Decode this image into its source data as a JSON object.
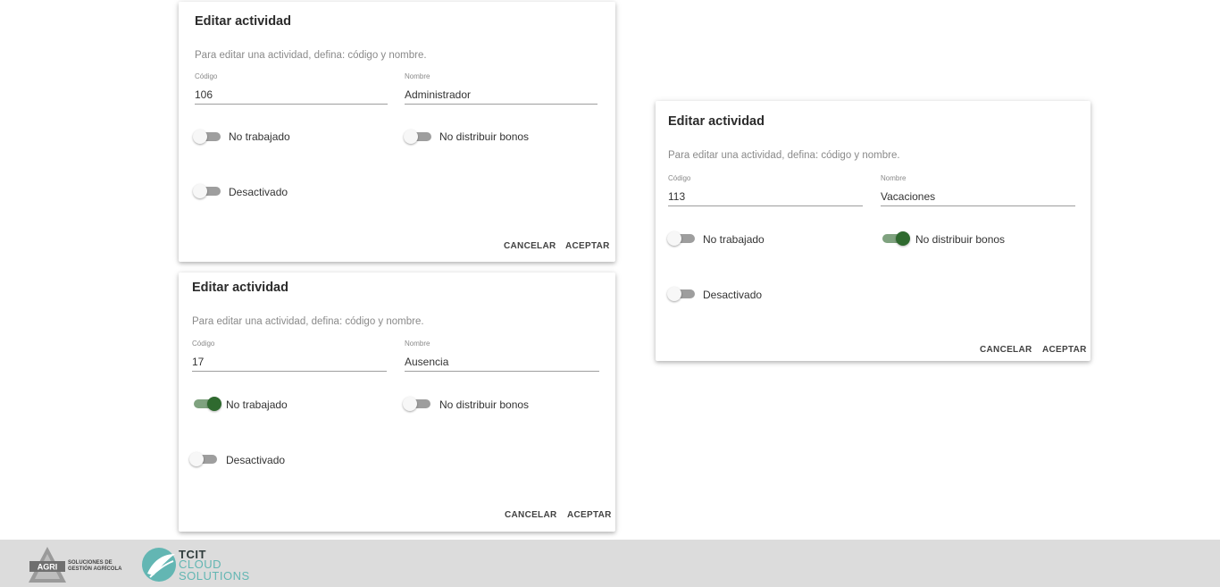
{
  "dialogs": [
    {
      "title": "Editar actividad",
      "subtitle": "Para editar una actividad, defina: código y nombre.",
      "codigo_label": "Código",
      "codigo_value": "106",
      "nombre_label": "Nombre",
      "nombre_value": "Administrador",
      "no_trabajado_label": "No trabajado",
      "no_trabajado_on": false,
      "no_distribuir_label": "No distribuir bonos",
      "no_distribuir_on": false,
      "desactivado_label": "Desactivado",
      "desactivado_on": false,
      "cancel_label": "CANCELAR",
      "accept_label": "ACEPTAR"
    },
    {
      "title": "Editar actividad",
      "subtitle": "Para editar una actividad, defina: código y nombre.",
      "codigo_label": "Código",
      "codigo_value": "17",
      "nombre_label": "Nombre",
      "nombre_value": "Ausencia",
      "no_trabajado_label": "No trabajado",
      "no_trabajado_on": true,
      "no_distribuir_label": "No distribuir bonos",
      "no_distribuir_on": false,
      "desactivado_label": "Desactivado",
      "desactivado_on": false,
      "cancel_label": "CANCELAR",
      "accept_label": "ACEPTAR"
    },
    {
      "title": "Editar actividad",
      "subtitle": "Para editar una actividad, defina: código y nombre.",
      "codigo_label": "Código",
      "codigo_value": "113",
      "nombre_label": "Nombre",
      "nombre_value": "Vacaciones",
      "no_trabajado_label": "No trabajado",
      "no_trabajado_on": false,
      "no_distribuir_label": "No distribuir bonos",
      "no_distribuir_on": true,
      "desactivado_label": "Desactivado",
      "desactivado_on": false,
      "cancel_label": "CANCELAR",
      "accept_label": "ACEPTAR"
    }
  ],
  "footer": {
    "agri_logo_text": "AGRI",
    "agri_tagline_1": "SOLUCIONES DE",
    "agri_tagline_2": "GESTIÓN AGRÍCOLA",
    "tcit_title": "TCIT",
    "tcit_line_1": "CLOUD",
    "tcit_line_2": "SOLUTIONS",
    "colors": {
      "toggle_on": "#2f6a2f",
      "toggle_on_track": "#7fa27f",
      "tcit_accent": "#63b6b3"
    }
  }
}
